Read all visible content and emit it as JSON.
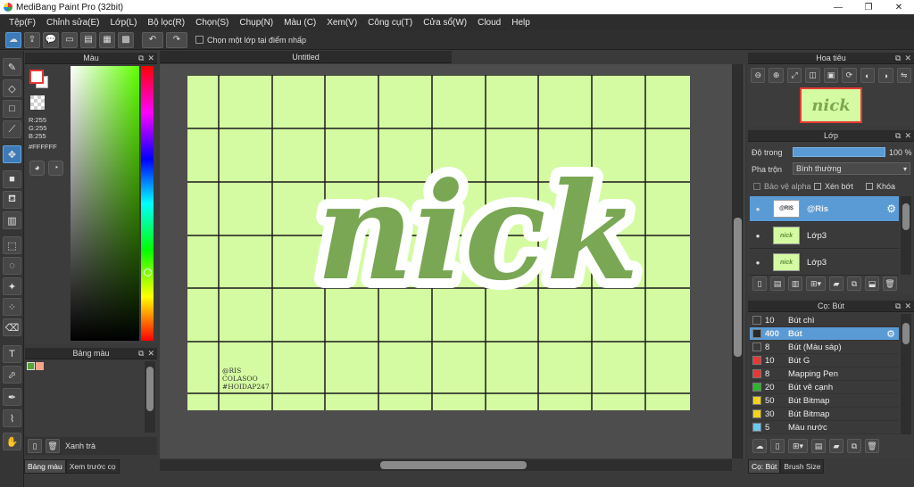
{
  "window": {
    "title": "MediBang Paint Pro (32bit)",
    "minimize": "—",
    "restore": "❐",
    "close": "✕"
  },
  "menu": [
    "Tệp(F)",
    "Chỉnh sửa(E)",
    "Lớp(L)",
    "Bộ lọc(R)",
    "Chọn(S)",
    "Chụp(N)",
    "Màu (C)",
    "Xem(V)",
    "Công cụ(T)",
    "Cửa sổ(W)",
    "Cloud",
    "Help"
  ],
  "toolbar": {
    "checkbox_label": "Chọn một lớp tại điểm nhấp"
  },
  "color_panel": {
    "title": "Màu",
    "r": "R:255",
    "g": "G:255",
    "b": "B:255",
    "hex": "#FFFFFF"
  },
  "palette_panel": {
    "title": "Bảng màu",
    "current": "Xanh trà",
    "colors": [
      "#57a639",
      "#f4a58a"
    ]
  },
  "left_tabs": [
    "Bảng màu",
    "Xem trước cọ"
  ],
  "canvas": {
    "tab_title": "Untitled",
    "paper_color": "#d5fba2",
    "grid_color": "#1a1a1a",
    "lettering": "nick",
    "lettering_color": "#7aa753",
    "credit": [
      "@RIS",
      "COLASOO",
      "#HOIDAP247"
    ]
  },
  "navigator": {
    "title": "Hoa tiêu",
    "thumb_text": "nick"
  },
  "layer_panel": {
    "title": "Lớp",
    "opacity_label": "Độ trong",
    "opacity_value": "100 %",
    "blend_label": "Pha trộn",
    "blend_value": "Bình thường",
    "protect_alpha": "Bảo vệ alpha",
    "clipping": "Xén bớt",
    "lock": "Khóa",
    "layers": [
      {
        "name": "@Ris",
        "thumb": "@RIS",
        "selected": true
      },
      {
        "name": "Lớp3",
        "thumb": "nick",
        "selected": false
      },
      {
        "name": "Lớp3",
        "thumb": "nick",
        "selected": false
      }
    ]
  },
  "brush_panel": {
    "title": "Cọ: Bút",
    "brushes": [
      {
        "size": "10",
        "name": "Bút chì",
        "color": "#3a3a3a",
        "selected": false
      },
      {
        "size": "400",
        "name": "Bút",
        "color": "#2a2a2a",
        "selected": true
      },
      {
        "size": "8",
        "name": "Bút (Màu sáp)",
        "color": "#3a3a3a",
        "selected": false
      },
      {
        "size": "10",
        "name": "Bút G",
        "color": "#e53935",
        "selected": false
      },
      {
        "size": "8",
        "name": "Mapping Pen",
        "color": "#e53935",
        "selected": false
      },
      {
        "size": "20",
        "name": "Bút vẽ cạnh",
        "color": "#2db52d",
        "selected": false
      },
      {
        "size": "50",
        "name": "Bút Bitmap",
        "color": "#f2d21b",
        "selected": false
      },
      {
        "size": "30",
        "name": "Bút Bitmap",
        "color": "#f2d21b",
        "selected": false
      },
      {
        "size": "5",
        "name": "Màu nước",
        "color": "#69c8ee",
        "selected": false
      }
    ]
  },
  "right_tabs": [
    "Cọ: Bút",
    "Brush Size"
  ]
}
